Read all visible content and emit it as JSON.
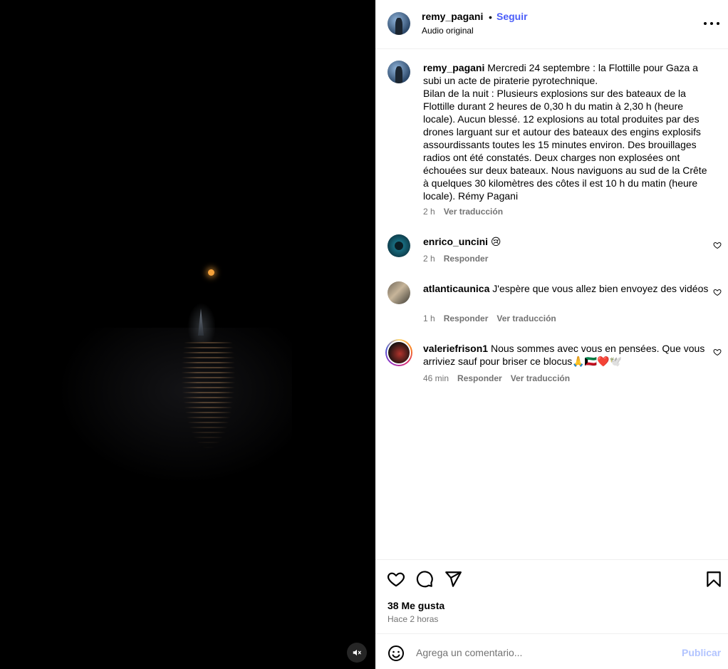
{
  "post": {
    "username": "remy_pagani",
    "separator": "•",
    "follow_label": "Seguir",
    "audio_label": "Audio original",
    "more_icon": "more-horizontal-icon"
  },
  "caption": {
    "username": "remy_pagani",
    "text": "Mercredi 24 septembre : la Flottille pour Gaza a subi un acte de piraterie pyrotechnique.",
    "text2": "Bilan de la nuit : Plusieurs explosions sur des bateaux de la Flottille durant 2 heures de 0,30 h du matin à 2,30 h (heure locale). Aucun blessé. 12 explosions au total produites par des drones larguant sur et autour des bateaux des engins explosifs assourdissants toutes les 15 minutes environ. Des brouillages radios ont été constatés. Deux charges non explosées ont échouées sur deux bateaux. Nous naviguons au sud de la Crête à quelques 30 kilomètres des côtes il est 10 h du matin (heure locale). Rémy Pagani",
    "time": "2 h",
    "translate_label": "Ver traducción"
  },
  "comments": [
    {
      "username": "enrico_uncini",
      "text": "😢",
      "time": "2 h",
      "reply_label": "Responder",
      "translate_label": ""
    },
    {
      "username": "atlanticaunica",
      "text": "J'espère que vous allez bien envoyez des vidéos",
      "time": "1 h",
      "reply_label": "Responder",
      "translate_label": "Ver traducción"
    },
    {
      "username": "valeriefrison1",
      "text": "Nous sommes avec vous en pensées. Que vous arriviez sauf pour briser ce blocus🙏🇰🇼❤️🕊️",
      "time": "46 min",
      "reply_label": "Responder",
      "translate_label": "Ver traducción"
    }
  ],
  "actions": {
    "likes": "38 Me gusta",
    "posted": "Hace 2 horas"
  },
  "composer": {
    "placeholder": "Agrega un comentario...",
    "publish_label": "Publicar"
  },
  "colors": {
    "accent": "#4a5df9",
    "muted": "#737373",
    "publish_disabled": "#b2c4ff"
  }
}
